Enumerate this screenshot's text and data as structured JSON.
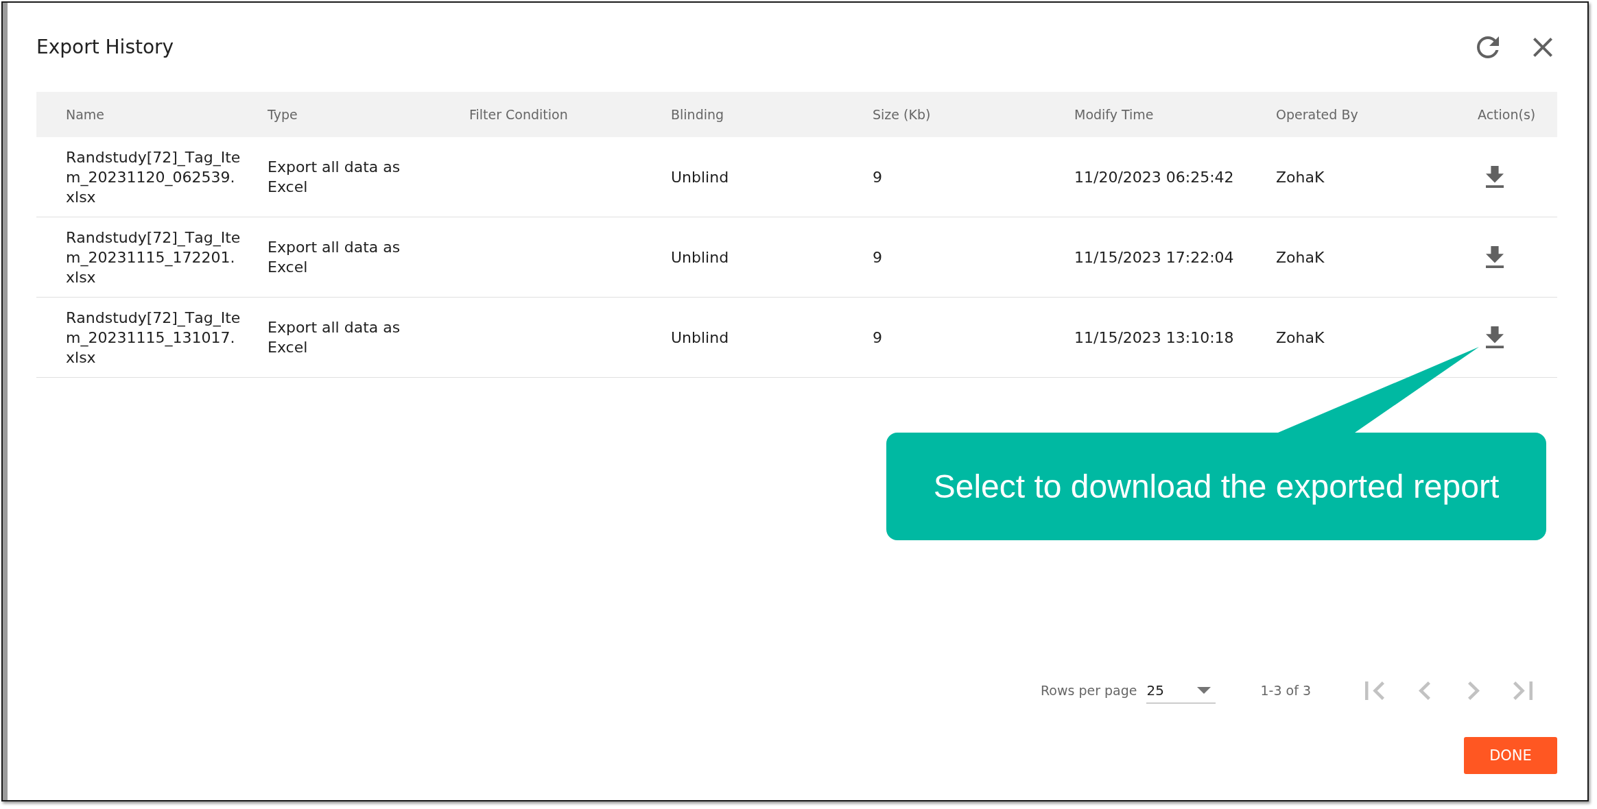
{
  "dialog": {
    "title": "Export History"
  },
  "table": {
    "columns": [
      "Name",
      "Type",
      "Filter Condition",
      "Blinding",
      "Size (Kb)",
      "Modify Time",
      "Operated By",
      "Action(s)"
    ],
    "rows": [
      {
        "name": "Randstudy[72]_Tag_Item_20231120_062539.xlsx",
        "type": "Export all data as Excel",
        "blinding": "Unblind",
        "size": "9",
        "modify_time": "11/20/2023 06:25:42",
        "operated_by": "ZohaK"
      },
      {
        "name": "Randstudy[72]_Tag_Item_20231115_172201.xlsx",
        "type": "Export all data as Excel",
        "blinding": "Unblind",
        "size": "9",
        "modify_time": "11/15/2023 17:22:04",
        "operated_by": "ZohaK"
      },
      {
        "name": "Randstudy[72]_Tag_Item_20231115_131017.xlsx",
        "type": "Export all data as Excel",
        "blinding": "Unblind",
        "size": "9",
        "modify_time": "11/15/2023 13:10:18",
        "operated_by": "ZohaK"
      }
    ]
  },
  "pagination": {
    "rows_per_page_label": "Rows per page",
    "rows_per_page": "25",
    "range": "1-3 of 3",
    "nav": [
      {
        "kind": "first",
        "disabled": true
      },
      {
        "kind": "previous",
        "disabled": true
      },
      {
        "kind": "next",
        "disabled": true
      },
      {
        "kind": "last",
        "disabled": true
      }
    ]
  },
  "done_button": {
    "label": "DONE"
  },
  "callout": {
    "text": "Select to download the exported report"
  }
}
